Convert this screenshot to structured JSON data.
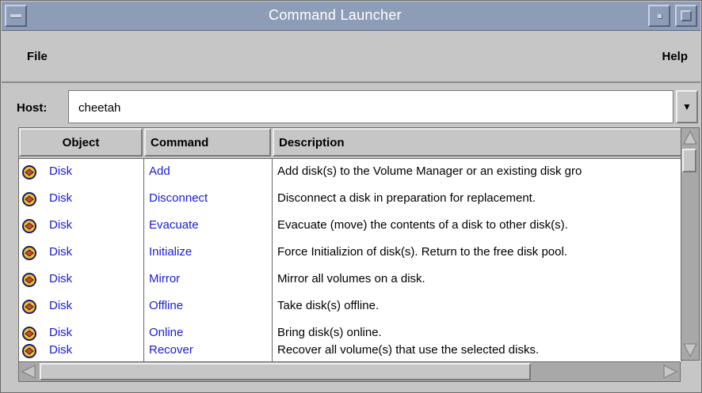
{
  "window": {
    "title": "Command Launcher"
  },
  "menubar": {
    "file_label": "File",
    "help_label": "Help"
  },
  "host": {
    "label": "Host:",
    "value": "cheetah"
  },
  "table": {
    "columns": [
      "Object",
      "Command",
      "Description"
    ],
    "rows": [
      {
        "object": "Disk",
        "command": "Add",
        "description": "Add disk(s) to the Volume Manager or an existing disk gro"
      },
      {
        "object": "Disk",
        "command": "Disconnect",
        "description": "Disconnect a disk in preparation for replacement."
      },
      {
        "object": "Disk",
        "command": "Evacuate",
        "description": "Evacuate (move) the contents of a disk to other disk(s)."
      },
      {
        "object": "Disk",
        "command": "Initialize",
        "description": "Force Initializion of disk(s). Return to the free disk pool."
      },
      {
        "object": "Disk",
        "command": "Mirror",
        "description": "Mirror all volumes on a disk."
      },
      {
        "object": "Disk",
        "command": "Offline",
        "description": "Take disk(s) offline."
      },
      {
        "object": "Disk",
        "command": "Online",
        "description": "Bring disk(s) online."
      },
      {
        "object": "Disk",
        "command": "Recover",
        "description": "Recover all volume(s) that use the selected disks."
      }
    ]
  },
  "icons": {
    "row_icon": "disk-icon",
    "dropdown_icon": "triangle-down-icon"
  },
  "colors": {
    "titlebar": "#8e9db7",
    "link": "#1a1ad6",
    "chrome": "#c6c6c6"
  }
}
